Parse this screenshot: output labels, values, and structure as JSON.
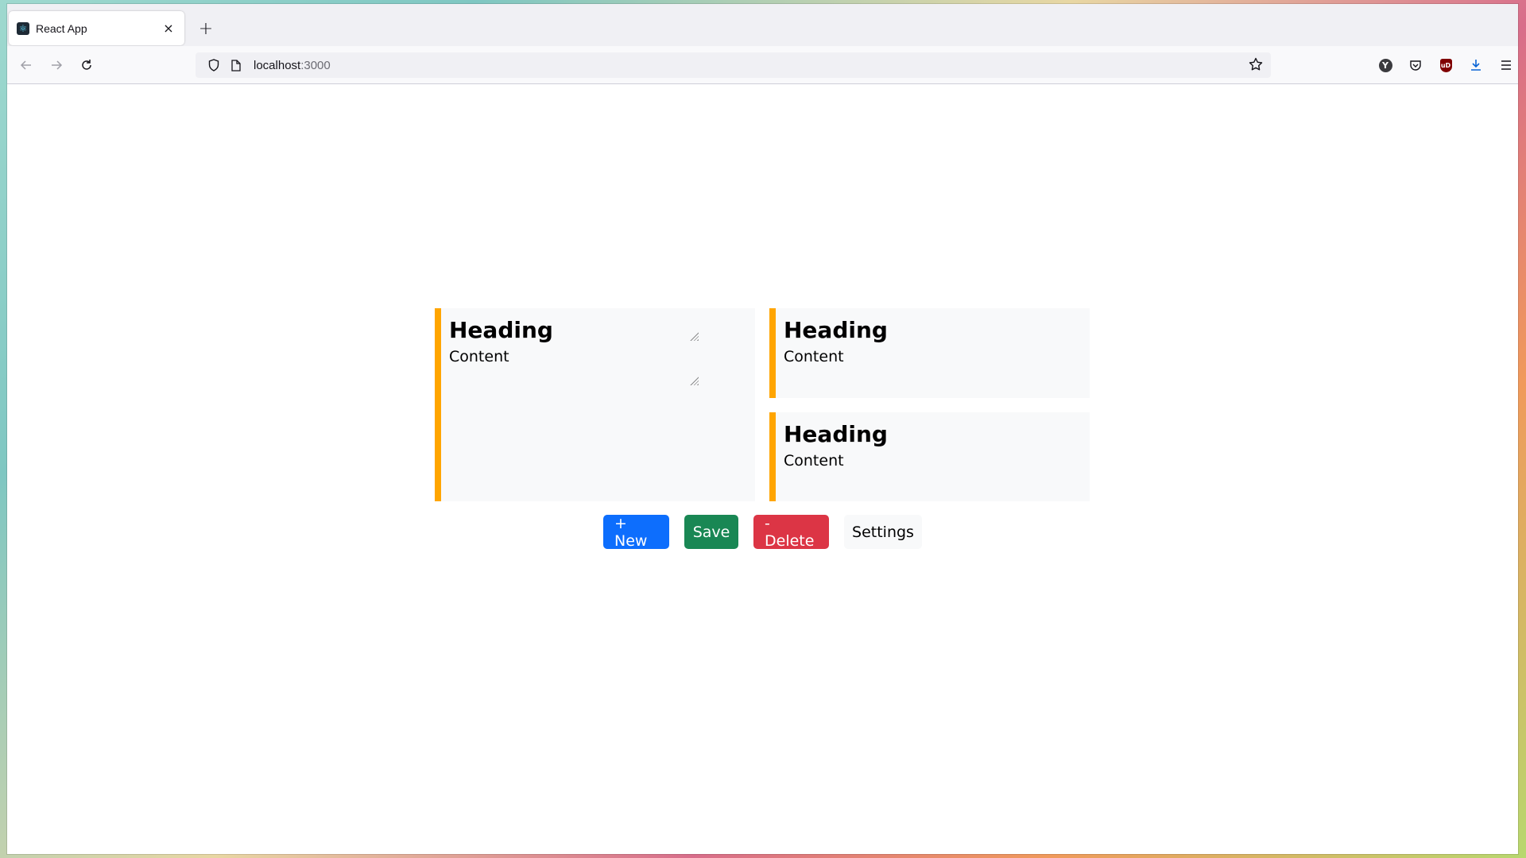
{
  "browser": {
    "tab_title": "React App",
    "tab_close": "×",
    "new_tab": "+",
    "url_host": "localhost",
    "url_port": ":3000",
    "icons": {
      "back": "back-arrow-icon",
      "forward": "forward-arrow-icon",
      "reload": "reload-icon",
      "shield": "shield-icon",
      "page": "page-icon",
      "bookmark": "star-icon",
      "extension_y": "Y",
      "pocket": "pocket-icon",
      "ublock": "uD",
      "downloads": "download-icon",
      "menu": "menu-icon"
    }
  },
  "cards": [
    {
      "heading": "Heading",
      "content": "Content"
    },
    {
      "heading": "Heading",
      "content": "Content"
    },
    {
      "heading": "Heading",
      "content": "Content"
    }
  ],
  "buttons": {
    "new": "+ New",
    "save": "Save",
    "delete": "- Delete",
    "settings": "Settings"
  },
  "colors": {
    "card_accent": "#ffa500",
    "card_bg": "#f8f9fa",
    "new": "#0d6efd",
    "save": "#198754",
    "delete": "#dc3545",
    "settings": "#f8f9fa"
  }
}
